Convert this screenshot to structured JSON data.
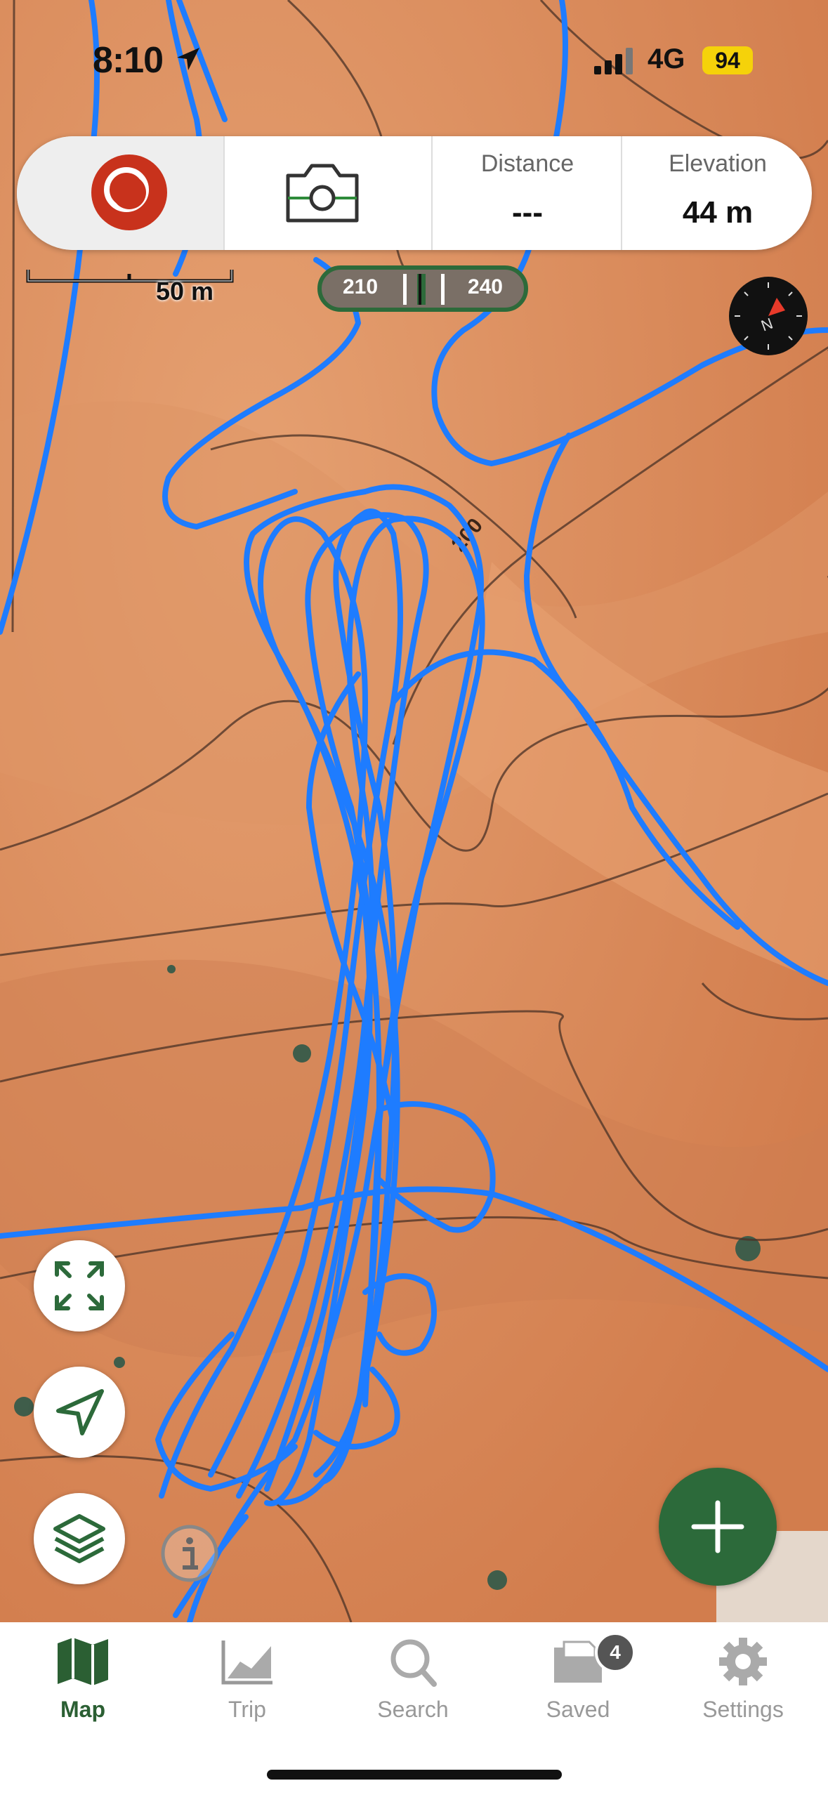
{
  "status_bar": {
    "time": "8:10",
    "network": "4G",
    "battery": "94"
  },
  "tracking_panel": {
    "distance_label": "Distance",
    "distance_value": "---",
    "elevation_label": "Elevation",
    "elevation_value": "44 m"
  },
  "map": {
    "scale_label": "50 m",
    "contour_label": "200",
    "heading_left": "210",
    "heading_right": "240",
    "compass_letter": "N"
  },
  "tabs": [
    {
      "label": "Map",
      "icon": "map-icon",
      "active": true
    },
    {
      "label": "Trip",
      "icon": "chart-icon",
      "active": false
    },
    {
      "label": "Search",
      "icon": "search-icon",
      "active": false
    },
    {
      "label": "Saved",
      "icon": "saved-icon",
      "active": false,
      "badge": "4"
    },
    {
      "label": "Settings",
      "icon": "gear-icon",
      "active": false
    }
  ],
  "colors": {
    "track": "#1e7cff",
    "accent_green": "#2c6a3a",
    "record_red": "#c8321c",
    "terrain": "#d98a5a"
  }
}
